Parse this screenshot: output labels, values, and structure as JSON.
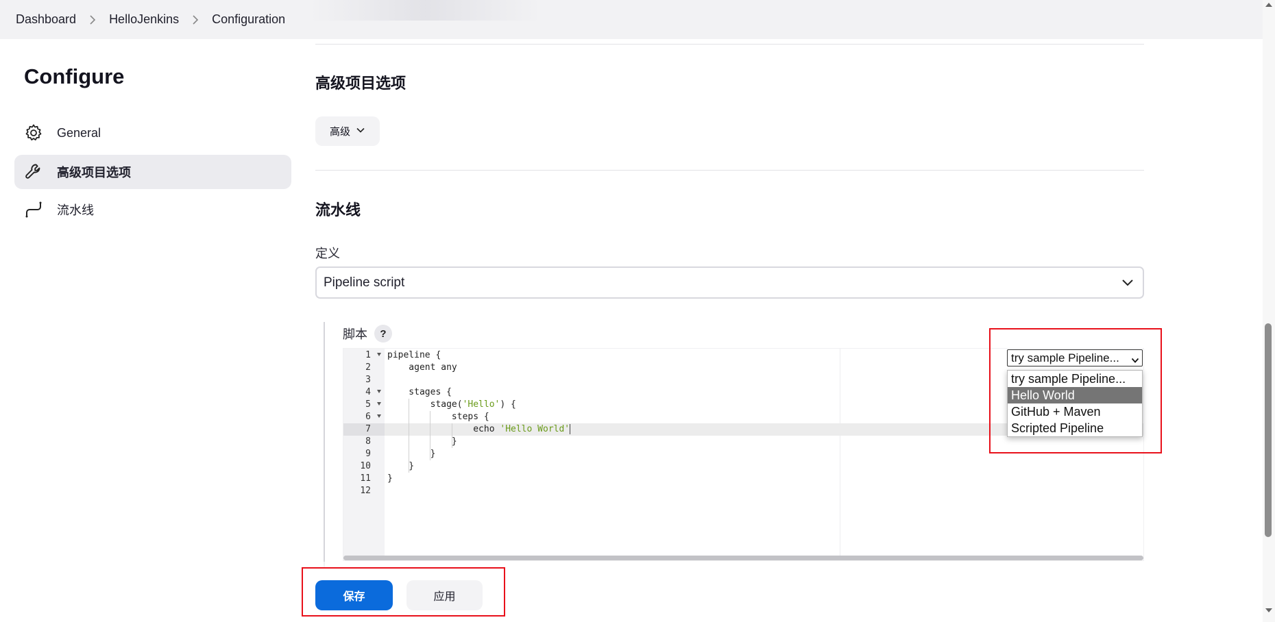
{
  "breadcrumb": {
    "items": [
      "Dashboard",
      "HelloJenkins",
      "Configuration"
    ]
  },
  "sidebar": {
    "title": "Configure",
    "items": [
      {
        "label": "General",
        "icon": "gear-icon",
        "active": false
      },
      {
        "label": "高级项目选项",
        "icon": "wrench-icon",
        "active": true
      },
      {
        "label": "流水线",
        "icon": "pipeline-icon",
        "active": false
      }
    ]
  },
  "advanced": {
    "section_title": "高级项目选项",
    "button_label": "高级"
  },
  "pipeline": {
    "section_title": "流水线",
    "definition_label": "定义",
    "definition_value": "Pipeline script",
    "script_label": "脚本",
    "help_glyph": "?"
  },
  "editor": {
    "highlighted_line": 7,
    "lines": [
      {
        "num": "1",
        "text": "pipeline {",
        "fold": true
      },
      {
        "num": "2",
        "text": "    agent any",
        "fold": false
      },
      {
        "num": "3",
        "text": "",
        "fold": false
      },
      {
        "num": "4",
        "text": "    stages {",
        "fold": true
      },
      {
        "num": "5",
        "text": "        stage('Hello') {",
        "fold": true
      },
      {
        "num": "6",
        "text": "            steps {",
        "fold": true
      },
      {
        "num": "7",
        "text": "                echo 'Hello World'",
        "fold": false
      },
      {
        "num": "8",
        "text": "            }",
        "fold": false
      },
      {
        "num": "9",
        "text": "        }",
        "fold": false
      },
      {
        "num": "10",
        "text": "    }",
        "fold": false
      },
      {
        "num": "11",
        "text": "}",
        "fold": false
      },
      {
        "num": "12",
        "text": "",
        "fold": false
      }
    ]
  },
  "sample_pipeline": {
    "selected": "try sample Pipeline...",
    "options": [
      "try sample Pipeline...",
      "Hello World",
      "GitHub + Maven",
      "Scripted Pipeline"
    ],
    "highlighted_index": 1
  },
  "actions": {
    "save_label": "保存",
    "apply_label": "应用"
  },
  "colors": {
    "primary": "#0b6bdc",
    "annotation": "#e8101a",
    "string": "#6a9b1a"
  }
}
